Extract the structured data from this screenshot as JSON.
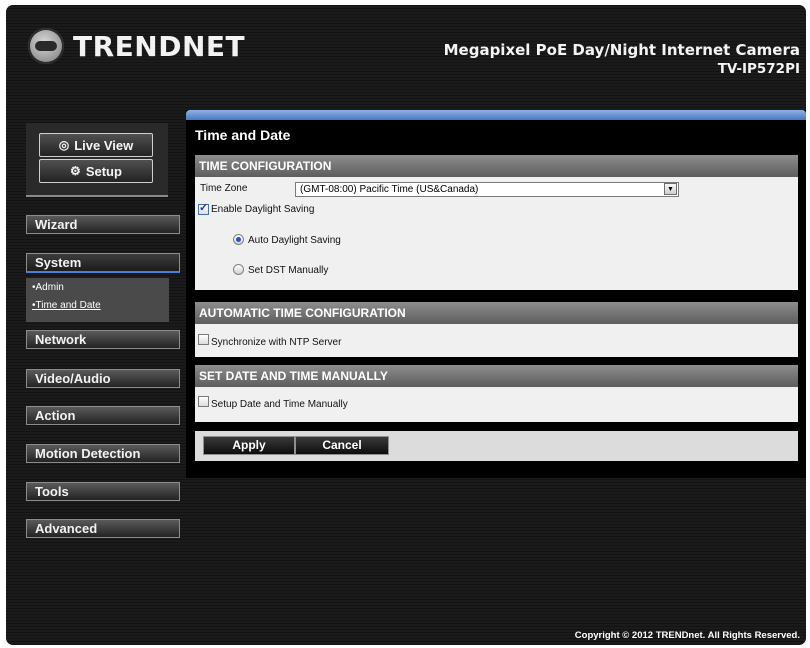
{
  "header": {
    "logo_text": "TRENDNET",
    "model_line1": "Megapixel PoE Day/Night Internet Camera",
    "model_line2": "TV-IP572PI"
  },
  "view_buttons": {
    "live_view": "Live View",
    "setup": "Setup"
  },
  "nav": {
    "items": [
      {
        "label": "Wizard"
      },
      {
        "label": "System"
      },
      {
        "label": "Network"
      },
      {
        "label": "Video/Audio"
      },
      {
        "label": "Action"
      },
      {
        "label": "Motion Detection"
      },
      {
        "label": "Tools"
      },
      {
        "label": "Advanced"
      }
    ],
    "active": "System",
    "submenu": [
      "•Admin",
      "•Time and Date"
    ]
  },
  "main": {
    "page_title": "Time and Date",
    "time_config": {
      "header": "TIME CONFIGURATION",
      "time_zone_label": "Time Zone",
      "time_zone_value": "(GMT-08:00) Pacific Time (US&Canada)",
      "enable_dst_label": "Enable Daylight Saving",
      "enable_dst_checked": true,
      "auto_dst_label": "Auto Daylight Saving",
      "manual_dst_label": "Set DST Manually",
      "dst_mode": "auto"
    },
    "auto_time": {
      "header": "AUTOMATIC TIME CONFIGURATION",
      "ntp_label": "Synchronize with NTP Server",
      "ntp_checked": false
    },
    "manual_time": {
      "header": "SET DATE AND TIME MANUALLY",
      "manual_label": "Setup Date and Time Manually",
      "manual_checked": false
    },
    "buttons": {
      "apply": "Apply",
      "cancel": "Cancel"
    }
  },
  "footer": {
    "copyright": "Copyright © 2012 TRENDnet. All Rights Reserved."
  },
  "colors": {
    "accent_blue": "#4a7fd8",
    "section_header": "#7a7a7a",
    "panel_bg": "#f0f0f0"
  }
}
